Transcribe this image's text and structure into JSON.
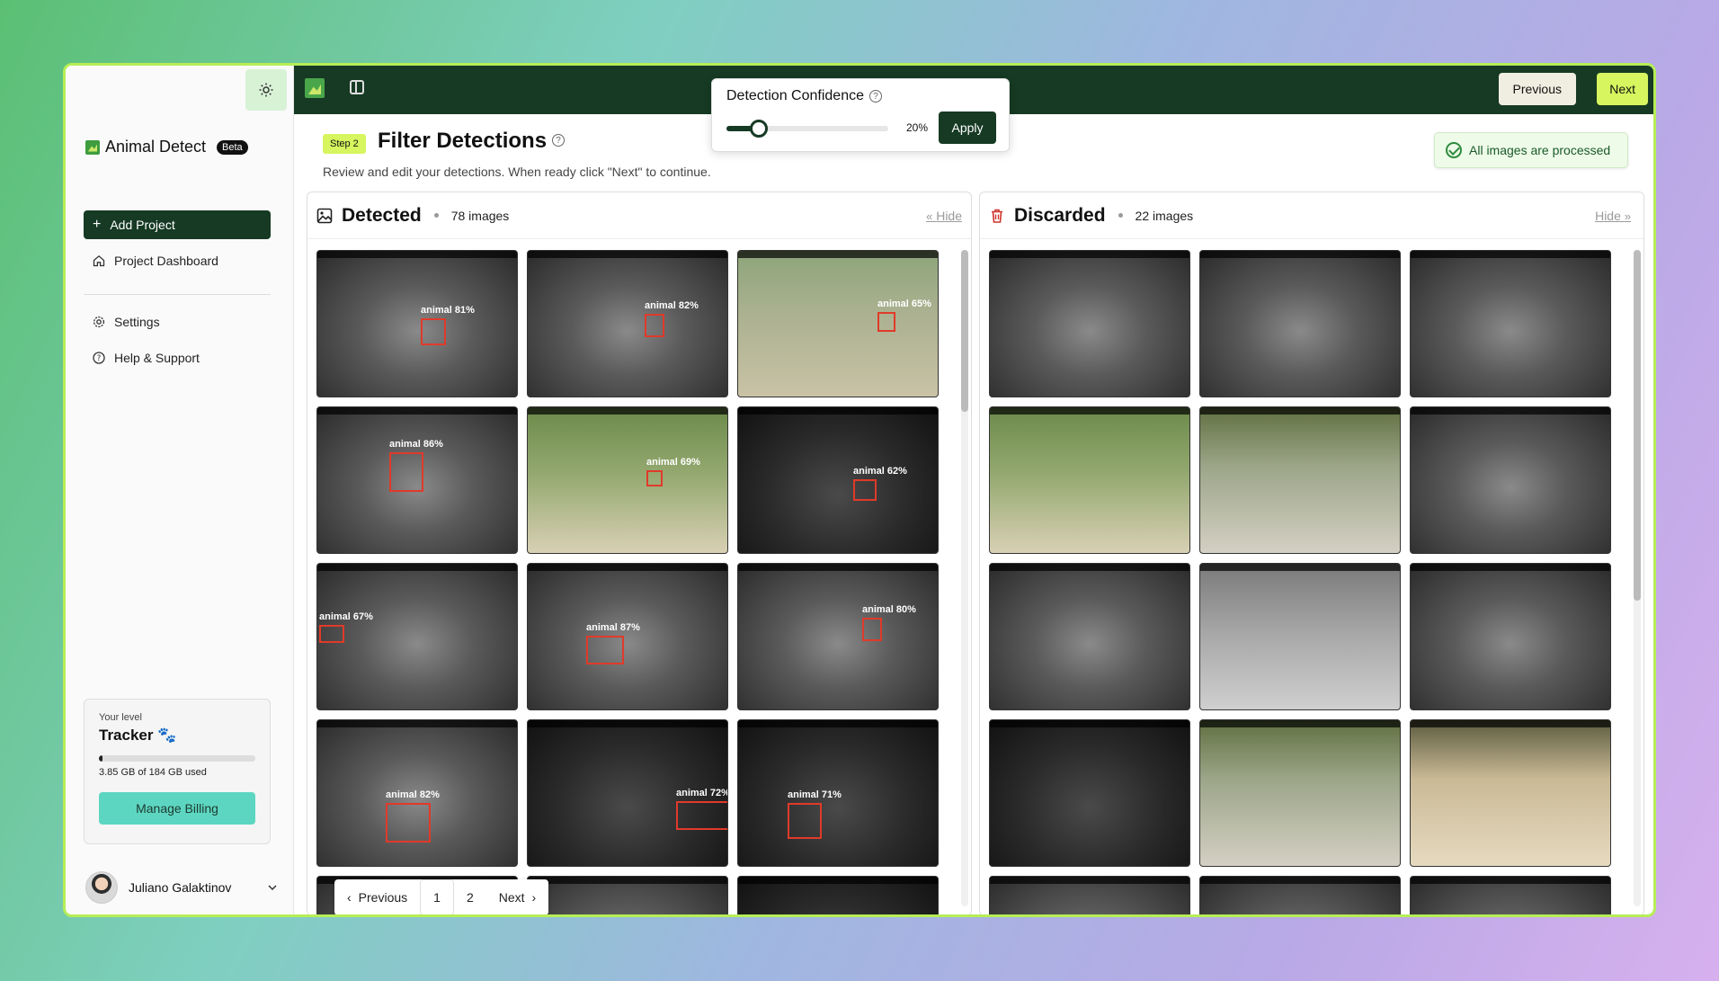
{
  "brand": {
    "name": "Animal Detect",
    "badge": "Beta"
  },
  "sidebar": {
    "add_project": "Add Project",
    "items": [
      {
        "label": "Project Dashboard",
        "icon": "home-icon"
      },
      {
        "label": "Settings",
        "icon": "gear-icon"
      },
      {
        "label": "Help & Support",
        "icon": "help-circle-icon"
      }
    ],
    "level": {
      "label": "Your level",
      "name": "Tracker 🐾",
      "usage": "3.85 GB of 184 GB used",
      "usage_fraction": 0.021,
      "billing": "Manage Billing"
    },
    "user": {
      "name": "Juliano Galaktinov"
    }
  },
  "topbar": {
    "previous": "Previous",
    "next": "Next"
  },
  "confidence": {
    "title": "Detection Confidence",
    "value": "20%",
    "value_fraction": 0.2,
    "apply": "Apply"
  },
  "header": {
    "step": "Step 2",
    "title": "Filter Detections",
    "subtitle": "Review and edit your detections. When ready click \"Next\" to continue.",
    "status": "All images are processed"
  },
  "detected": {
    "title": "Detected",
    "count": "78 images",
    "hide": "Hide",
    "thumbs": [
      {
        "label": "animal 81%"
      },
      {
        "label": "animal 82%"
      },
      {
        "label": "animal 65%"
      },
      {
        "label": "animal 86%"
      },
      {
        "label": "animal 69%"
      },
      {
        "label": "animal 62%"
      },
      {
        "label": "animal 67%"
      },
      {
        "label": "animal 87%"
      },
      {
        "label": "animal 80%"
      },
      {
        "label": "animal 82%"
      },
      {
        "label": "animal 72%"
      },
      {
        "label": "animal 71%"
      }
    ]
  },
  "discarded": {
    "title": "Discarded",
    "count": "22 images",
    "hide": "Hide"
  },
  "pagination": {
    "previous": "Previous",
    "pages": [
      "1",
      "2"
    ],
    "next": "Next"
  },
  "colors": {
    "accent": "#163a24",
    "lime": "#d6f55e",
    "teal": "#5dd6c1",
    "box": "#e03a2a"
  }
}
